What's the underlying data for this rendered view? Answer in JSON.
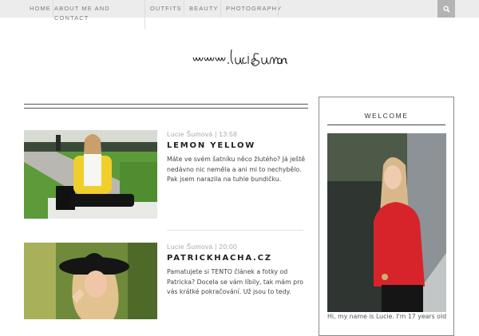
{
  "nav": {
    "items": [
      "Home",
      "About me and contact",
      "Outfits",
      "Beauty",
      "Photography"
    ],
    "search_icon": "search-icon"
  },
  "logo": {
    "text": "www.luciesumova.com"
  },
  "posts": [
    {
      "meta": "Lucie Šumová | 13:58",
      "title": "Lemon Yellow",
      "excerpt": "Máte ve svém šatníku něco žlutého? Já ještě nedávno nic neměla a ani mi to nechybělo. Pak jsem narazila na tuhle bundičku."
    },
    {
      "meta": "Lucie Šumová | 20:00",
      "title": "Patrickhacha.cz",
      "excerpt": "Pamatujete si TENTO článek a fotky od Patricka? Docela se vám líbily, tak mám pro vás krátké pokračování. Už jsou to tedy."
    }
  ],
  "sidebar": {
    "title": "Welcome",
    "text": "Hi, my name is Lucie. I'm 17 years old"
  },
  "colors": {
    "nav_bg": "#ececec",
    "search_bg": "#b4b4b4",
    "text": "#222222",
    "meta": "#aaaaaa"
  }
}
